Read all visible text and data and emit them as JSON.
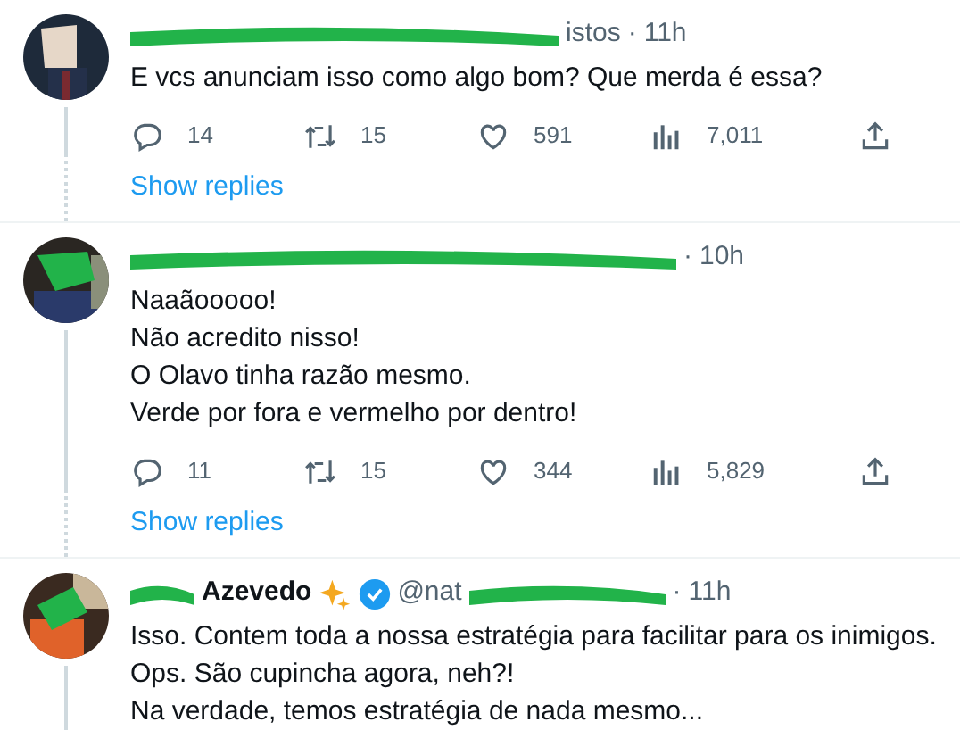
{
  "tweets": [
    {
      "header_visible": "istos",
      "separator": "·",
      "time": "11h",
      "lines": [
        "E vcs anunciam isso como algo bom? Que merda é essa?"
      ],
      "stats": {
        "replies": "14",
        "retweets": "15",
        "likes": "591",
        "views": "7,011"
      },
      "show_replies": "Show replies",
      "thread": true
    },
    {
      "separator": "·",
      "time": "10h",
      "lines": [
        "Naaãooooo!",
        "Não acredito nisso!",
        "O Olavo tinha razão mesmo.",
        "Verde por fora e vermelho por dentro!"
      ],
      "stats": {
        "replies": "11",
        "retweets": "15",
        "likes": "344",
        "views": "5,829"
      },
      "show_replies": "Show replies",
      "thread": true
    },
    {
      "name": "Azevedo",
      "sparkle": true,
      "verified": true,
      "handle": "@nat",
      "separator": "·",
      "time": "11h",
      "lines": [
        "Isso. Contem toda a nossa estratégia para facilitar para os inimigos.",
        "Ops. São cupincha agora, neh?!",
        "Na verdade, temos estratégia de nada mesmo..."
      ],
      "thread": true
    }
  ]
}
